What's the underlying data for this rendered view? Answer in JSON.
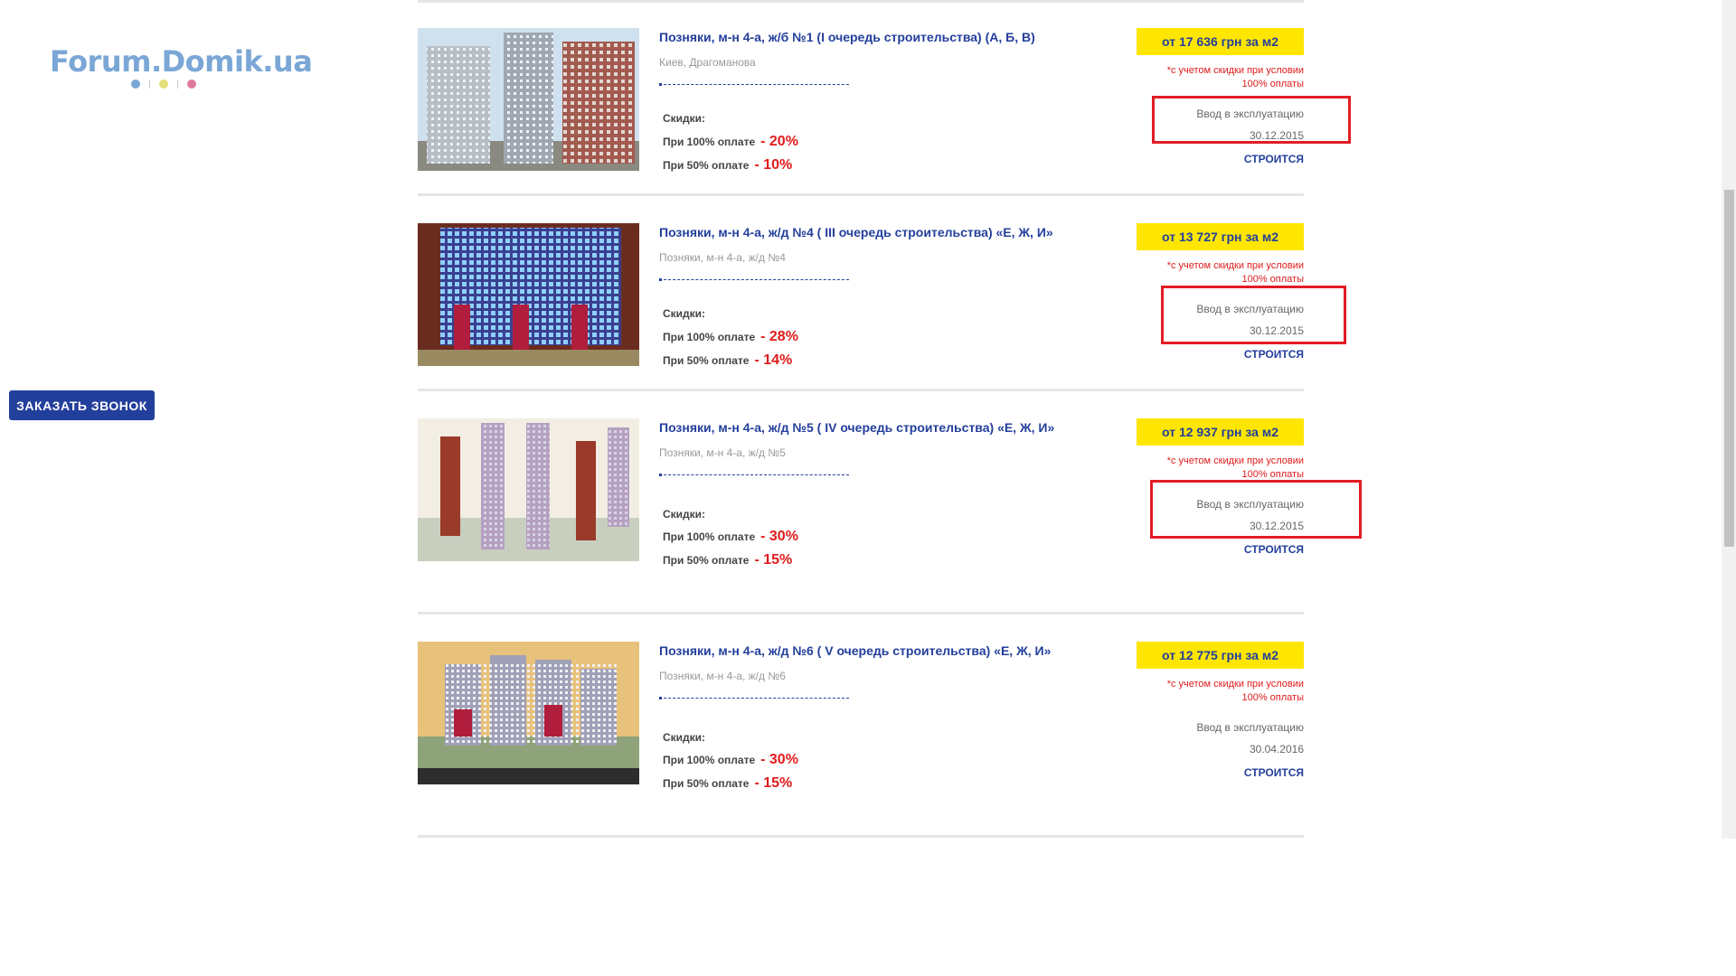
{
  "logo": {
    "text": "Forum.Domik.ua",
    "dot_colors": [
      "#7aa7d6",
      "#e6e07a",
      "#e07a9a"
    ]
  },
  "call_button": "ЗАКАЗАТЬ ЗВОНОК",
  "colors": {
    "brand_blue": "#233f9c",
    "price_yellow": "#ffe600",
    "discount_red": "#e01b1b",
    "highlight_red": "#e21c24"
  },
  "listings": [
    {
      "title": "Позняки, м-н 4-а, ж/б №1 (I очередь строительства) (А, Б, В)",
      "address": "Киев, Драгоманова",
      "discount_head": "Скидки:",
      "disc100_label": "При 100% оплате",
      "disc100_value": "- 20%",
      "disc50_label": "При 50% оплате",
      "disc50_value": "- 10%",
      "price": "от 17 636 грн за м2",
      "price_note_1": "*с учетом скидки при условии",
      "price_note_2": "100% оплаты",
      "commission_label": "Ввод в эксплуатацию",
      "commission_date": "30.12.2015",
      "status": "СТРОИТСЯ",
      "highlighted": true
    },
    {
      "title": "Позняки, м-н 4-а, ж/д №4 ( III очередь строительства) «Е, Ж, И»",
      "address": "Позняки, м-н 4-а, ж/д №4",
      "discount_head": "Скидки:",
      "disc100_label": "При 100% оплате",
      "disc100_value": "- 28%",
      "disc50_label": "При 50% оплате",
      "disc50_value": "- 14%",
      "price": "от 13 727 грн за м2",
      "price_note_1": "*с учетом скидки при условии",
      "price_note_2": "100% оплаты",
      "commission_label": "Ввод в эксплуатацию",
      "commission_date": "30.12.2015",
      "status": "СТРОИТСЯ",
      "highlighted": true
    },
    {
      "title": "Позняки, м-н 4-а, ж/д №5 ( IV очередь строительства) «Е, Ж, И»",
      "address": "Позняки, м-н 4-а, ж/д №5",
      "discount_head": "Скидки:",
      "disc100_label": "При 100% оплате",
      "disc100_value": "- 30%",
      "disc50_label": "При 50% оплате",
      "disc50_value": "- 15%",
      "price": "от 12 937 грн за м2",
      "price_note_1": "*с учетом скидки при условии",
      "price_note_2": "100% оплаты",
      "commission_label": "Ввод в эксплуатацию",
      "commission_date": "30.12.2015",
      "status": "СТРОИТСЯ",
      "highlighted": true
    },
    {
      "title": "Позняки, м-н 4-а, ж/д №6 ( V очередь строительства) «Е, Ж, И»",
      "address": "Позняки, м-н 4-а, ж/д №6",
      "discount_head": "Скидки:",
      "disc100_label": "При 100% оплате",
      "disc100_value": "- 30%",
      "disc50_label": "При 50% оплате",
      "disc50_value": "- 15%",
      "price": "от 12 775 грн за м2",
      "price_note_1": "*с учетом скидки при условии",
      "price_note_2": "100% оплаты",
      "commission_label": "Ввод в эксплуатацию",
      "commission_date": "30.04.2016",
      "status": "СТРОИТСЯ",
      "highlighted": false
    }
  ]
}
